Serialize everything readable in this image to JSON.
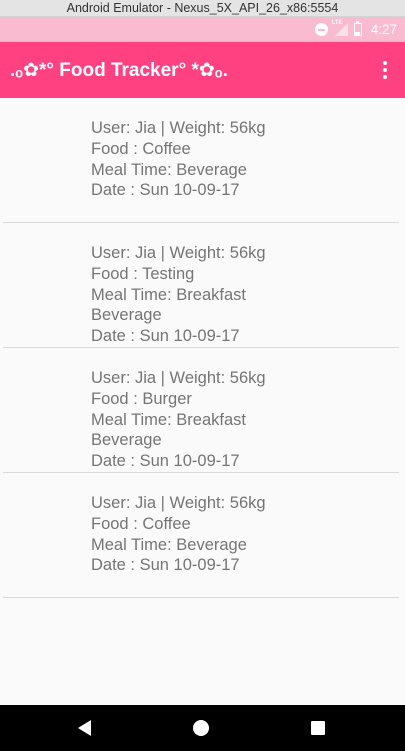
{
  "window": {
    "title": "Android Emulator - Nexus_5X_API_26_x86:5554"
  },
  "status_bar": {
    "network_label": "LTE",
    "time": "4:27"
  },
  "app_bar": {
    "title": ".ₒ✿*° Food Tracker° *✿ₒ."
  },
  "entries": [
    {
      "user": "User: Jia | Weight: 56kg",
      "food": "Food : Coffee",
      "meal_time": "Meal Time:  Beverage",
      "meal_time_2": "",
      "date": "Date : Sun 10-09-17"
    },
    {
      "user": "User: Jia | Weight: 56kg",
      "food": "Food : Testing",
      "meal_time": "Meal Time: Breakfast",
      "meal_time_2": "Beverage",
      "date": "Date : Sun 10-09-17"
    },
    {
      "user": "User: Jia | Weight: 56kg",
      "food": "Food : Burger",
      "meal_time": "Meal Time: Breakfast",
      "meal_time_2": "Beverage",
      "date": "Date : Sun 10-09-17"
    },
    {
      "user": "User: Jia | Weight: 56kg",
      "food": "Food : Coffee",
      "meal_time": "Meal Time:  Beverage",
      "meal_time_2": "",
      "date": "Date : Sun 10-09-17"
    }
  ],
  "icons": {
    "status": [
      "do-not-disturb-icon",
      "lte-signal-icon",
      "battery-icon"
    ],
    "app_bar": [
      "overflow-menu-icon"
    ],
    "nav": [
      "back-icon",
      "home-icon",
      "recents-icon"
    ]
  },
  "colors": {
    "app_bar": "#ff4081",
    "status_bar": "#f8bbcf",
    "text": "#757575"
  }
}
